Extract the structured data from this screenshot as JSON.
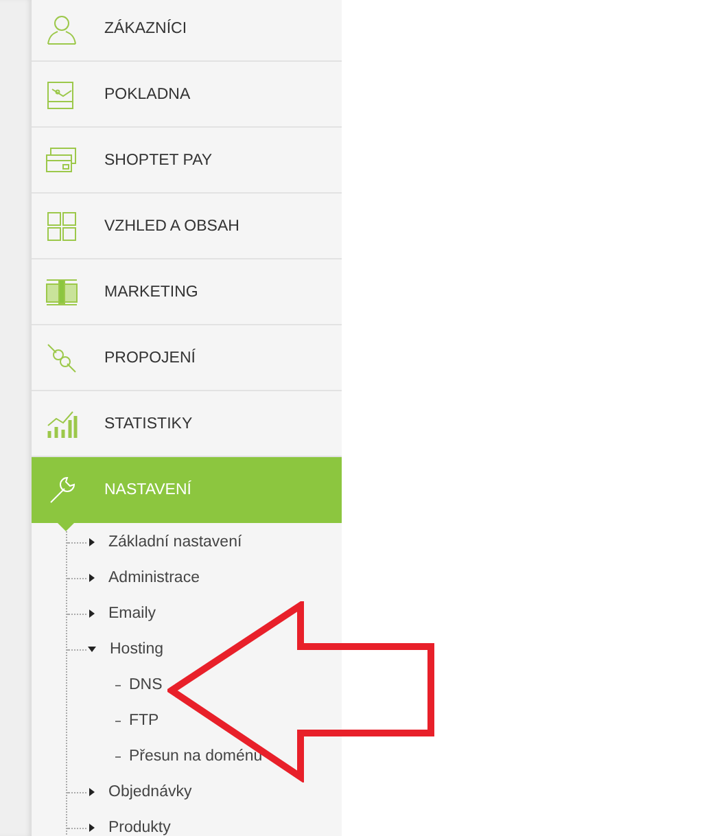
{
  "sidebar": {
    "items": [
      {
        "label": "ZÁKAZNÍCI",
        "selected": false
      },
      {
        "label": "POKLADNA",
        "selected": false
      },
      {
        "label": "SHOPTET PAY",
        "selected": false
      },
      {
        "label": "VZHLED A OBSAH",
        "selected": false
      },
      {
        "label": "MARKETING",
        "selected": false
      },
      {
        "label": "PROPOJENÍ",
        "selected": false
      },
      {
        "label": "STATISTIKY",
        "selected": false
      },
      {
        "label": "NASTAVENÍ",
        "selected": true,
        "children": [
          {
            "label": "Základní nastavení",
            "expanded": false
          },
          {
            "label": "Administrace",
            "expanded": false
          },
          {
            "label": "Emaily",
            "expanded": false
          },
          {
            "label": "Hosting",
            "expanded": true,
            "children": [
              {
                "label": "DNS"
              },
              {
                "label": "FTP"
              },
              {
                "label": "Přesun na doménu"
              }
            ]
          },
          {
            "label": "Objednávky",
            "expanded": false
          },
          {
            "label": "Produkty",
            "expanded": false
          }
        ]
      }
    ]
  }
}
